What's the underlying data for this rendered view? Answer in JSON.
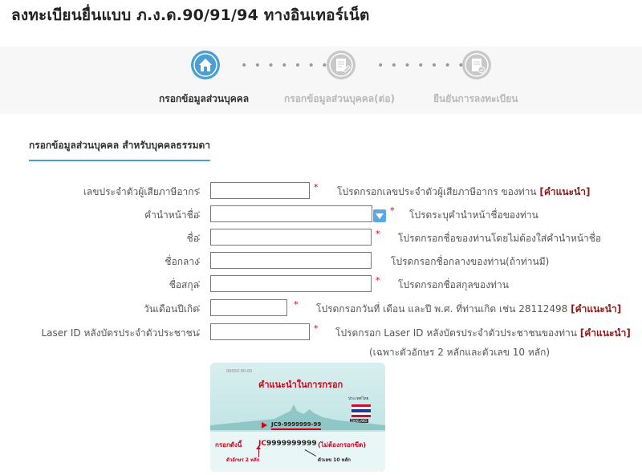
{
  "page": {
    "title": "ลงทะเบียนยื่นแบบ ภ.ง.ด.90/91/94 ทางอินเทอร์เน็ต"
  },
  "steps": [
    {
      "label": "กรอกข้อมูลส่วนบุคคล",
      "state": "active",
      "icon": "home-icon",
      "color": "#4a9fd5"
    },
    {
      "label": "กรอกข้อมูลส่วนบุคคล(ต่อ)",
      "state": "inactive",
      "icon": "edit-document-icon",
      "color": "#c8c8c8"
    },
    {
      "label": "ยืนยันการลงทะเบียน",
      "state": "inactive",
      "icon": "confirm-document-icon",
      "color": "#c8c8c8"
    }
  ],
  "step_separator": "• • • • • • •",
  "form": {
    "section_title": "กรอกข้อมูลส่วนบุคคล สำหรับบุคคลธรรมดา",
    "colon": ":",
    "required_mark": "*",
    "fields": {
      "tax_id": {
        "label": "เลขประจำตัวผู้เสียภาษีอากร",
        "value": "",
        "help": "โปรดกรอกเลขประจำตัวผู้เสียภาษีอากร ของท่าน",
        "hint": "[คำแนะนำ]"
      },
      "title_prefix": {
        "label": "คำนำหน้าชื่อ",
        "value": "",
        "help": "โปรดระบุคำนำหน้าชื่อของท่าน"
      },
      "first_name": {
        "label": "ชื่อ",
        "value": "",
        "help": "โปรดกรอกชื่อของท่านโดยไม่ต้องใส่คำนำหน้าชื่อ"
      },
      "middle_name": {
        "label": "ชื่อกลาง",
        "value": "",
        "help": "โปรดกรอกชื่อกลางของท่าน(ถ้าท่านมี)"
      },
      "last_name": {
        "label": "ชื่อสกุล",
        "value": "",
        "help": "โปรดกรอกชื่อสกุลของท่าน"
      },
      "birth_date": {
        "label": "วันเดือนปีเกิด",
        "value": "",
        "help": "โปรดกรอกวันที่ เดือน และปี พ.ศ. ที่ท่านเกิด เช่น 28112498",
        "hint": "[คำแนะนำ]"
      },
      "laser_id": {
        "label": "Laser ID หลังบัตรประจำตัวประชาชน",
        "value": "",
        "help": "โปรดกรอก Laser ID หลังบัตรประจำตัวประชาชนของท่าน",
        "hint": "[คำแนะนำ]"
      }
    },
    "laser_note": "(เฉพาะตัวอักษร 2 หลักและตัวเลข 10 หลัก)"
  },
  "card_example": {
    "card_number": "00000-00-00",
    "title": "คำแนะนำในการกรอก",
    "country_label": "ประเทศไทย",
    "country_sub": "THAILAND",
    "laser_sample": "JC9-9999999-99",
    "fill_like": "กรอกดังนี้",
    "sample_prefix": "JC",
    "sample_digits": "9999999999",
    "no_dash": "(ไม่ต้องกรอกขีด)",
    "letters_note": "ตัวอักษร 2 หลัก",
    "digits_note": "ตัวเลข 10 หลัก",
    "flag_colors": [
      "#c8102e",
      "#ffffff",
      "#1f3a93",
      "#ffffff",
      "#c8102e"
    ]
  }
}
